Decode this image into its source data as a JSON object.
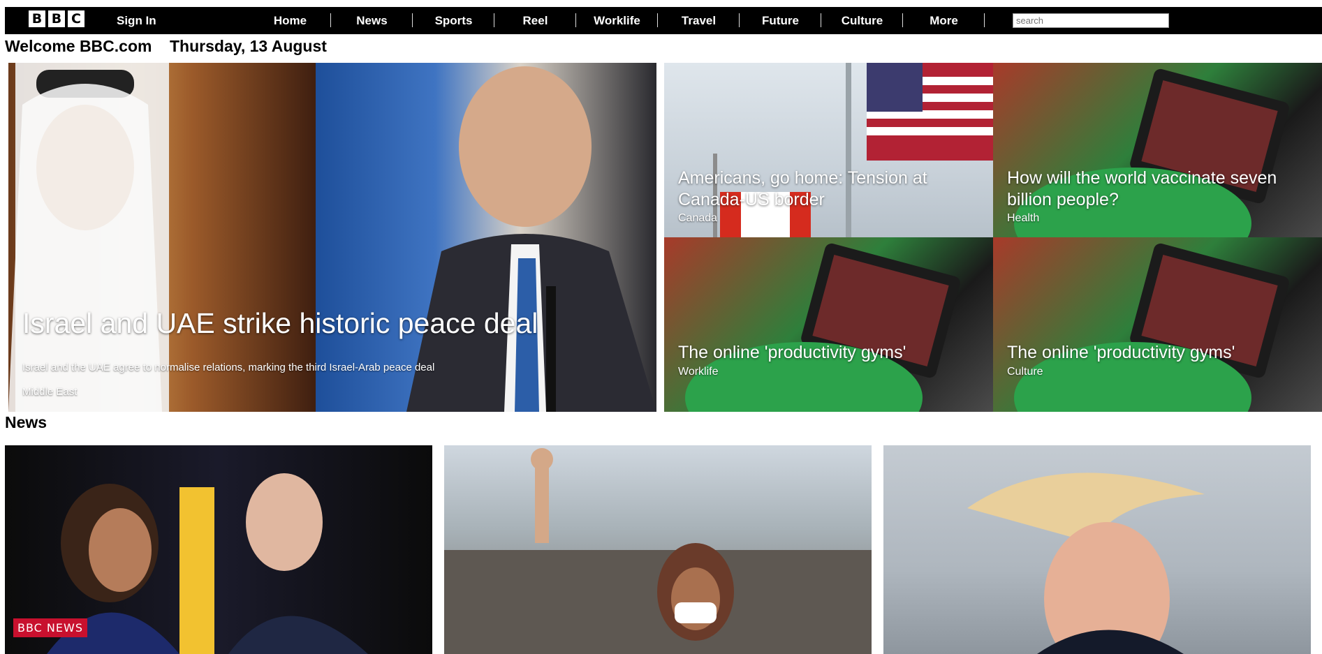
{
  "brand": {
    "letters": [
      "B",
      "B",
      "C"
    ]
  },
  "header": {
    "signin": "Sign In",
    "nav": [
      "Home",
      "News",
      "Sports",
      "Reel",
      "Worklife",
      "Travel",
      "Future",
      "Culture",
      "More"
    ],
    "search_placeholder": "search"
  },
  "welcome": "Welcome BBC.com",
  "date": "Thursday, 13 August",
  "hero": {
    "headline": "Israel and UAE strike historic peace deal",
    "summary": "Israel and the UAE agree to normalise relations, marking the third Israel-Arab peace deal",
    "tag": "Middle East"
  },
  "tiles": [
    {
      "title": "Americans, go home: Tension at Canada-US border",
      "category": "Canada"
    },
    {
      "title": "How will the world vaccinate seven billion people?",
      "category": "Health"
    },
    {
      "title": "The online 'productivity gyms'",
      "category": "Worklife"
    },
    {
      "title": "The online 'productivity gyms'",
      "category": "Culture"
    }
  ],
  "news_section": {
    "title": "News",
    "badge": "BBC NEWS"
  }
}
